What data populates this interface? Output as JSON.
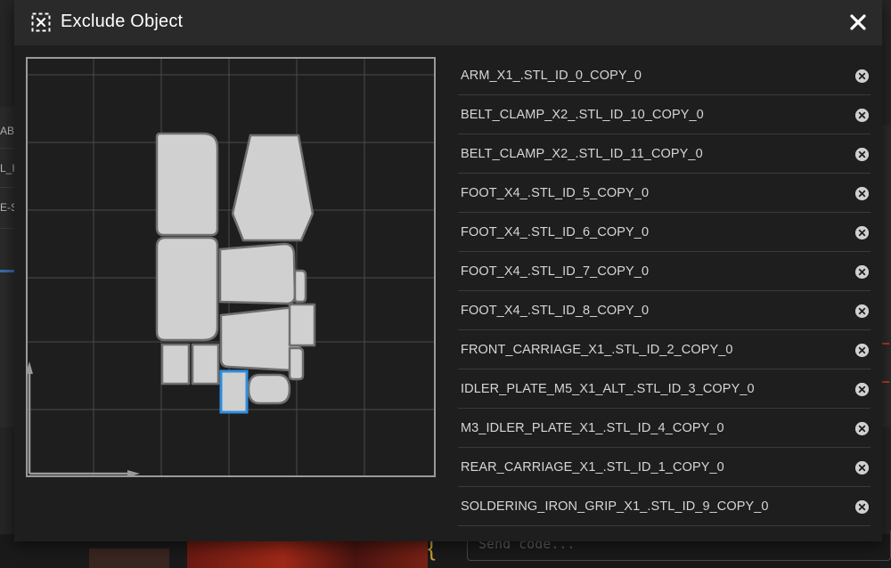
{
  "dialog": {
    "title": "Exclude Object",
    "title_icon": "exclude-object-icon",
    "close_icon": "close-icon"
  },
  "background": {
    "left_fragments": [
      "ABS",
      "L_I",
      "E-S"
    ],
    "send_placeholder": "Send code..."
  },
  "objects": [
    {
      "name": "ARM_X1_.STL_ID_0_COPY_0"
    },
    {
      "name": "BELT_CLAMP_X2_.STL_ID_10_COPY_0"
    },
    {
      "name": "BELT_CLAMP_X2_.STL_ID_11_COPY_0"
    },
    {
      "name": "FOOT_X4_.STL_ID_5_COPY_0"
    },
    {
      "name": "FOOT_X4_.STL_ID_6_COPY_0"
    },
    {
      "name": "FOOT_X4_.STL_ID_7_COPY_0"
    },
    {
      "name": "FOOT_X4_.STL_ID_8_COPY_0"
    },
    {
      "name": "FRONT_CARRIAGE_X1_.STL_ID_2_COPY_0"
    },
    {
      "name": "IDLER_PLATE_M5_X1_ALT_.STL_ID_3_COPY_0"
    },
    {
      "name": "M3_IDLER_PLATE_X1_.STL_ID_4_COPY_0"
    },
    {
      "name": "REAR_CARRIAGE_X1_.STL_ID_1_COPY_0"
    },
    {
      "name": "SOLDERING_IRON_GRIP_X1_.STL_ID_9_COPY_0"
    }
  ],
  "colors": {
    "part_fill": "#d0d0d0",
    "part_stroke": "#6f6f6f",
    "highlight": "#2f8fe0",
    "grid": "#4a4a4a",
    "axis": "#9a9a9a"
  }
}
